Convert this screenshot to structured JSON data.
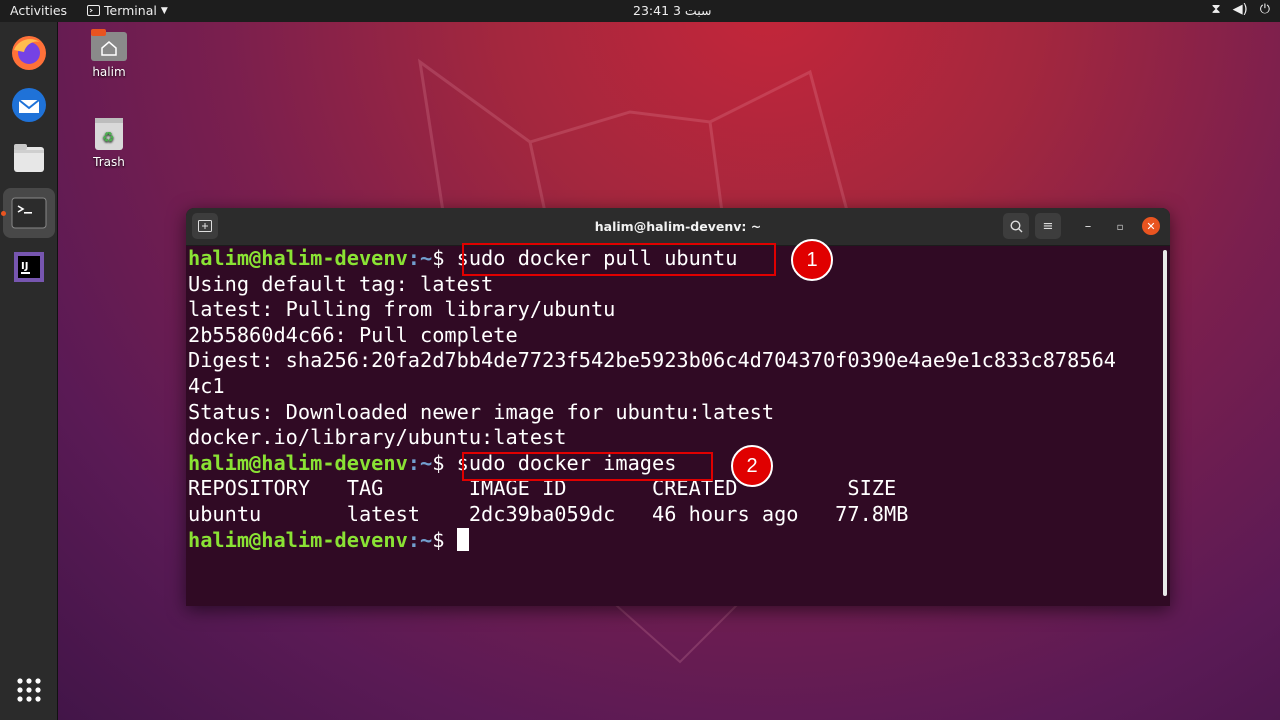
{
  "topbar": {
    "activities": "Activities",
    "app_menu": "Terminal",
    "clock": "23:41 سبت 3",
    "status_icons": [
      "network-icon",
      "volume-icon",
      "power-icon"
    ]
  },
  "dock": {
    "items": [
      "firefox-icon",
      "thunderbird-icon",
      "files-icon",
      "terminal-icon",
      "intellij-icon"
    ],
    "show_apps": "show-applications-icon"
  },
  "desktop": {
    "home_label": "halim",
    "trash_label": "Trash"
  },
  "terminal": {
    "title": "halim@halim-devenv: ~",
    "prompt_user": "halim@halim-devenv",
    "prompt_path": ":~",
    "prompt_symbol": "$ ",
    "cmd1": "sudo docker pull ubuntu",
    "out1": "Using default tag: latest",
    "out2": "latest: Pulling from library/ubuntu",
    "out3": "2b55860d4c66: Pull complete",
    "out4": "Digest: sha256:20fa2d7bb4de7723f542be5923b06c4d704370f0390e4ae9e1c833c878564",
    "out5": "4c1",
    "out6": "Status: Downloaded newer image for ubuntu:latest",
    "out7": "docker.io/library/ubuntu:latest",
    "cmd2": "sudo docker images",
    "table_header": "REPOSITORY   TAG       IMAGE ID       CREATED         SIZE",
    "table_row": "ubuntu       latest    2dc39ba059dc   46 hours ago   77.8MB"
  },
  "annotations": {
    "badge1": "1",
    "badge2": "2"
  },
  "colors": {
    "terminal_bg": "#300a24",
    "prompt_green": "#8ae234",
    "prompt_blue": "#729fcf",
    "highlight_red": "#e00000",
    "ubuntu_orange": "#e95420"
  }
}
